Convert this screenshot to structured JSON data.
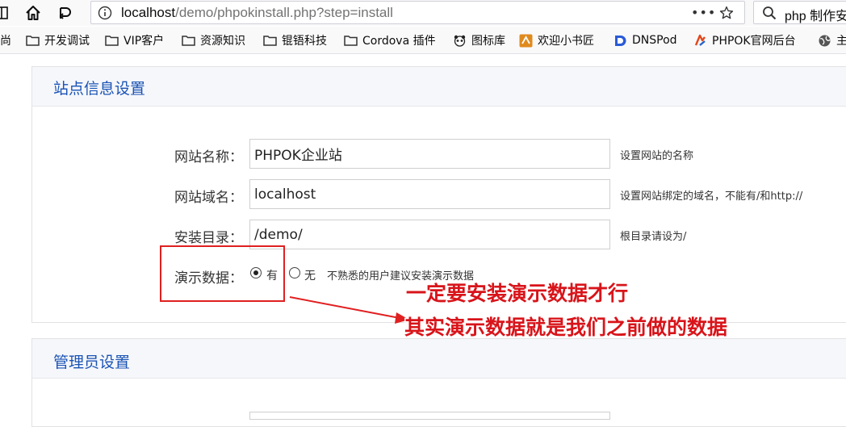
{
  "browser": {
    "nav": {
      "reader_icon": "reader-view-icon",
      "home_icon": "home-icon",
      "sync_icon": "sync-icon"
    },
    "url": {
      "host": "localhost",
      "path": "/demo/phpokinstall.php?step=install"
    },
    "url_actions": {
      "more_label": "•••",
      "star_icon": "star-icon"
    },
    "search": {
      "value": "php 制作安"
    },
    "bookmarks": [
      {
        "label": "尚"
      },
      {
        "label": "开发调试"
      },
      {
        "label": "VIP客户"
      },
      {
        "label": "资源知识"
      },
      {
        "label": "锟铻科技"
      },
      {
        "label": "Cordova 插件"
      },
      {
        "label": "图标库"
      },
      {
        "label": "欢迎小书匠"
      },
      {
        "label": "DNSPod"
      },
      {
        "label": "PHPOK官网后台"
      },
      {
        "label": "主"
      }
    ]
  },
  "site_settings": {
    "title": "站点信息设置",
    "fields": [
      {
        "label": "网站名称：",
        "value": "PHPOK企业站",
        "note": "设置网站的名称"
      },
      {
        "label": "网站域名：",
        "value": "localhost",
        "note": "设置网站绑定的域名，不能有/和http://"
      },
      {
        "label": "安装目录：",
        "value": "/demo/",
        "note": "根目录请设为/"
      }
    ],
    "demo_data": {
      "label": "演示数据：",
      "options": [
        {
          "label": "有",
          "selected": true
        },
        {
          "label": "无",
          "selected": false
        }
      ],
      "note": "不熟悉的用户建议安装演示数据"
    }
  },
  "admin_settings": {
    "title": "管理员设置"
  },
  "annotation": {
    "line1": "一定要安装演示数据才行",
    "line2": "其实演示数据就是我们之前做的数据",
    "color": "#d8141a"
  }
}
